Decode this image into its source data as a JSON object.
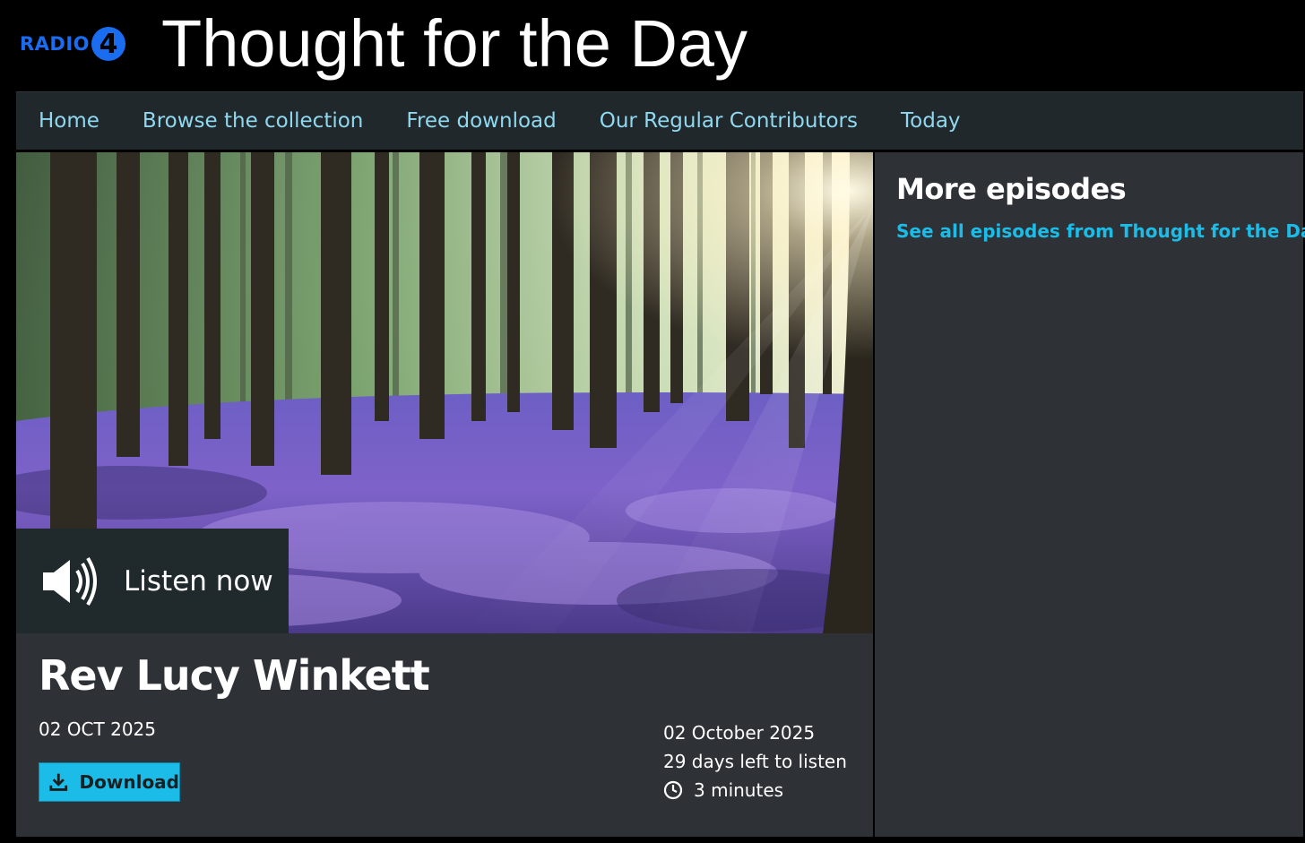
{
  "brand": {
    "logo_text": "RADIO",
    "logo_number": "4",
    "site_title": "Thought for the Day",
    "accent_color": "#1a6cf0"
  },
  "nav": {
    "items": [
      {
        "label": "Home"
      },
      {
        "label": "Browse the collection"
      },
      {
        "label": "Free download"
      },
      {
        "label": "Our Regular Contributors"
      },
      {
        "label": "Today"
      }
    ]
  },
  "hero": {
    "image_icon": "bluebell-woodland-image",
    "listen_label": "Listen now",
    "listen_icon": "speaker-icon"
  },
  "episode": {
    "title": "Rev Lucy Winkett",
    "date_short": "02 OCT 2025",
    "download_label": "Download",
    "download_icon": "download-icon",
    "date_long": "02 October 2025",
    "availability": "29 days left to listen",
    "duration": "3 minutes",
    "duration_icon": "clock-icon",
    "button_color": "#1bbde8"
  },
  "side": {
    "heading": "More episodes",
    "link": "See all episodes from Thought for the Day",
    "link_color": "#1bbde8"
  }
}
